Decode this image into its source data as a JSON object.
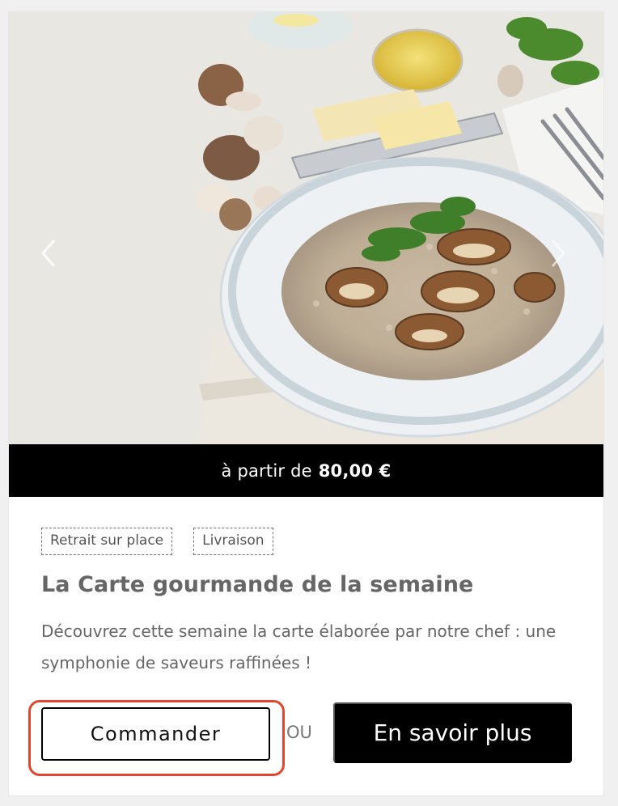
{
  "card": {
    "image": {
      "alt": "Risotto aux champignons",
      "prev_icon": "chevron-left-icon",
      "next_icon": "chevron-right-icon"
    },
    "price": {
      "prefix": "à partir de",
      "amount": "80,00 €"
    },
    "tags": [
      "Retrait sur place",
      "Livraison"
    ],
    "title": "La Carte gourmande de la semaine",
    "description": "Découvrez cette semaine la carte élaborée par notre chef : une symphonie de saveurs raffinées !",
    "actions": {
      "order_label": "Commander",
      "separator": "OU",
      "more_label": "En savoir plus"
    }
  },
  "colors": {
    "highlight": "#e2452f",
    "button_dark": "#000000",
    "text_muted": "#666666"
  }
}
